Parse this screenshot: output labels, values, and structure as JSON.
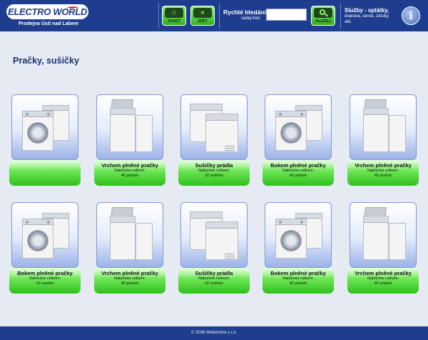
{
  "header": {
    "logo_text": "ELECTRO WORLD",
    "store_name": "Prodejna Ústí nad Labem",
    "start_label": "START",
    "back_label": "ZPĚT",
    "quick_search_title": "Rychlé hledání",
    "quick_search_hint": "zadej kód:",
    "quick_search_value": "",
    "search_label": "HLEDEJ",
    "services_title": "Služby - splátky,",
    "services_sub": "doprava, servis, záruky atd.",
    "info_label": "i"
  },
  "page_title": "Pračky, sušičky",
  "cards": [
    {
      "name": "",
      "count_line1": "",
      "count_line2": "",
      "image": "front-loader-washer-icon"
    },
    {
      "name": "Vrchem plněné pračky",
      "count_line1": "Nabízíme celkem:",
      "count_line2": "40 praček",
      "image": "top-loader-washer-icon"
    },
    {
      "name": "Sušičky prádla",
      "count_line1": "Nabízíme celkem:",
      "count_line2": "22 sušiček",
      "image": "tumble-dryer-icon"
    },
    {
      "name": "Bokem plněné pračky",
      "count_line1": "Nabízíme celkem:",
      "count_line2": "42 praček",
      "image": "front-loader-washer-icon"
    },
    {
      "name": "Vrchem plněné pračky",
      "count_line1": "Nabízíme celkem:",
      "count_line2": "40 praček",
      "image": "top-loader-washer-icon"
    },
    {
      "name": "Bokem plněné pračky",
      "count_line1": "Nabízíme celkem:",
      "count_line2": "42 praček",
      "image": "front-loader-washer-icon"
    },
    {
      "name": "Vrchem plněné pračky",
      "count_line1": "Nabízíme celkem:",
      "count_line2": "40 praček",
      "image": "top-loader-washer-icon"
    },
    {
      "name": "Sušičky prádla",
      "count_line1": "Nabízíme celkem:",
      "count_line2": "22 sušiček",
      "image": "tumble-dryer-icon"
    },
    {
      "name": "Bokem plněné pračky",
      "count_line1": "Nabízíme celkem:",
      "count_line2": "42 praček",
      "image": "front-loader-washer-icon"
    },
    {
      "name": "Vrchem plněné pračky",
      "count_line1": "Nabízíme celkem:",
      "count_line2": "40 praček",
      "image": "top-loader-washer-icon"
    }
  ],
  "footer": {
    "copyright": "© 2006 WebActive s.r.o."
  },
  "colors": {
    "header_bg": "#1e3d8f",
    "accent_green": "#3fcf28",
    "title_blue": "#1c2f72"
  }
}
